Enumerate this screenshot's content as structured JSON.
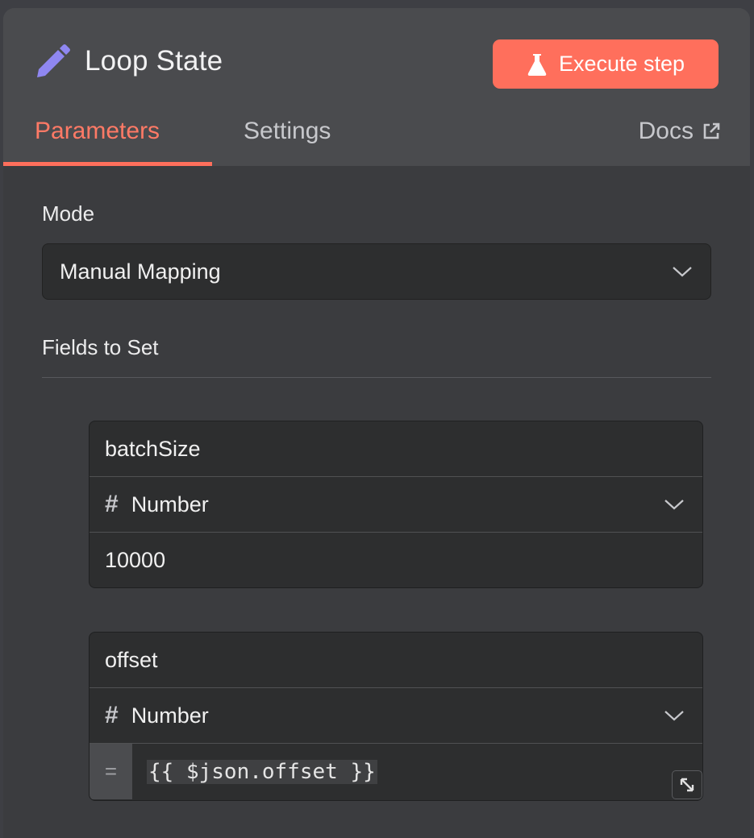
{
  "node": {
    "title": "Loop State",
    "icon": "pencil-icon"
  },
  "header": {
    "execute_label": "Execute step",
    "execute_icon": "flask-icon",
    "accent_color": "#ff6f5c"
  },
  "tabs": {
    "parameters": "Parameters",
    "settings": "Settings",
    "docs": "Docs",
    "active": "Parameters"
  },
  "mode": {
    "label": "Mode",
    "value": "Manual Mapping"
  },
  "fields": {
    "label": "Fields to Set",
    "items": [
      {
        "name": "batchSize",
        "type": "Number",
        "value": "10000"
      },
      {
        "name": "offset",
        "type": "Number",
        "expression_marker": "=",
        "value": "{{ $json.offset }}"
      }
    ]
  }
}
